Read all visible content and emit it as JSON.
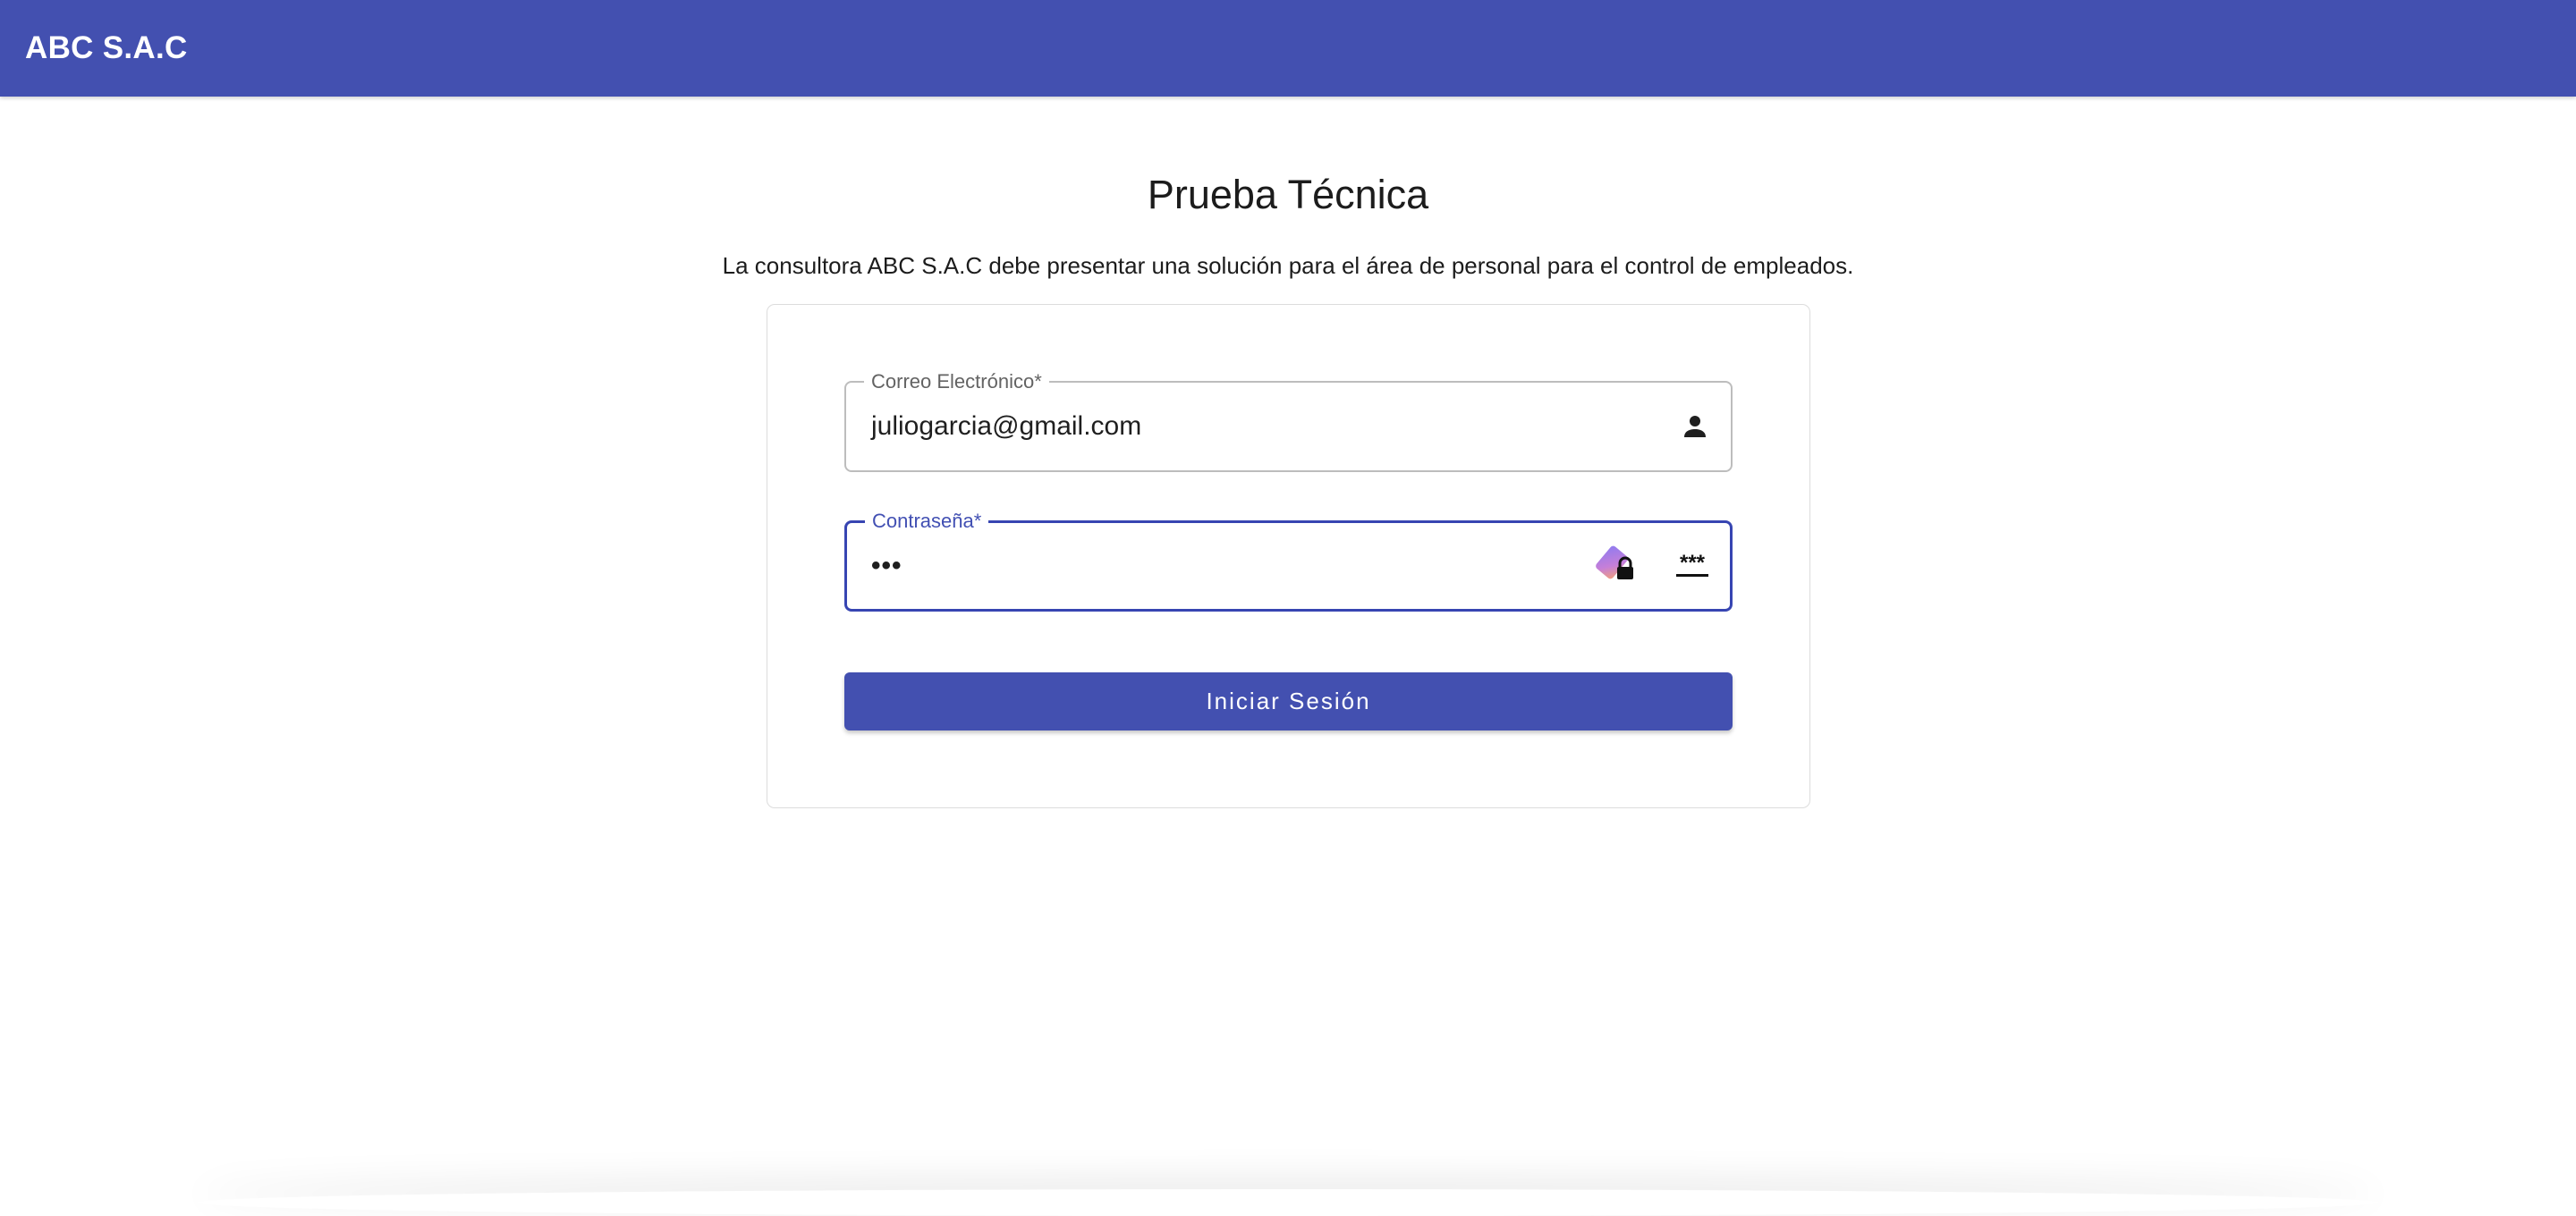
{
  "header": {
    "app_title": "ABC S.A.C"
  },
  "main": {
    "title": "Prueba Técnica",
    "description": "La consultora ABC S.A.C debe presentar una solución para el área de personal para el control de empleados."
  },
  "login_form": {
    "email": {
      "label": "Correo Electrónico*",
      "value": "juliogarcia@gmail.com",
      "icon": "person-icon"
    },
    "password": {
      "label": "Contraseña*",
      "value": "•••",
      "icons": [
        "password-manager-icon",
        "password-generator-icon"
      ],
      "focused": true
    },
    "submit_label": "Iniciar Sesión"
  },
  "colors": {
    "primary": "#4350b0",
    "focus_border": "#3745b2",
    "label_focused": "#4250b3",
    "text": "#1f1f1f"
  }
}
